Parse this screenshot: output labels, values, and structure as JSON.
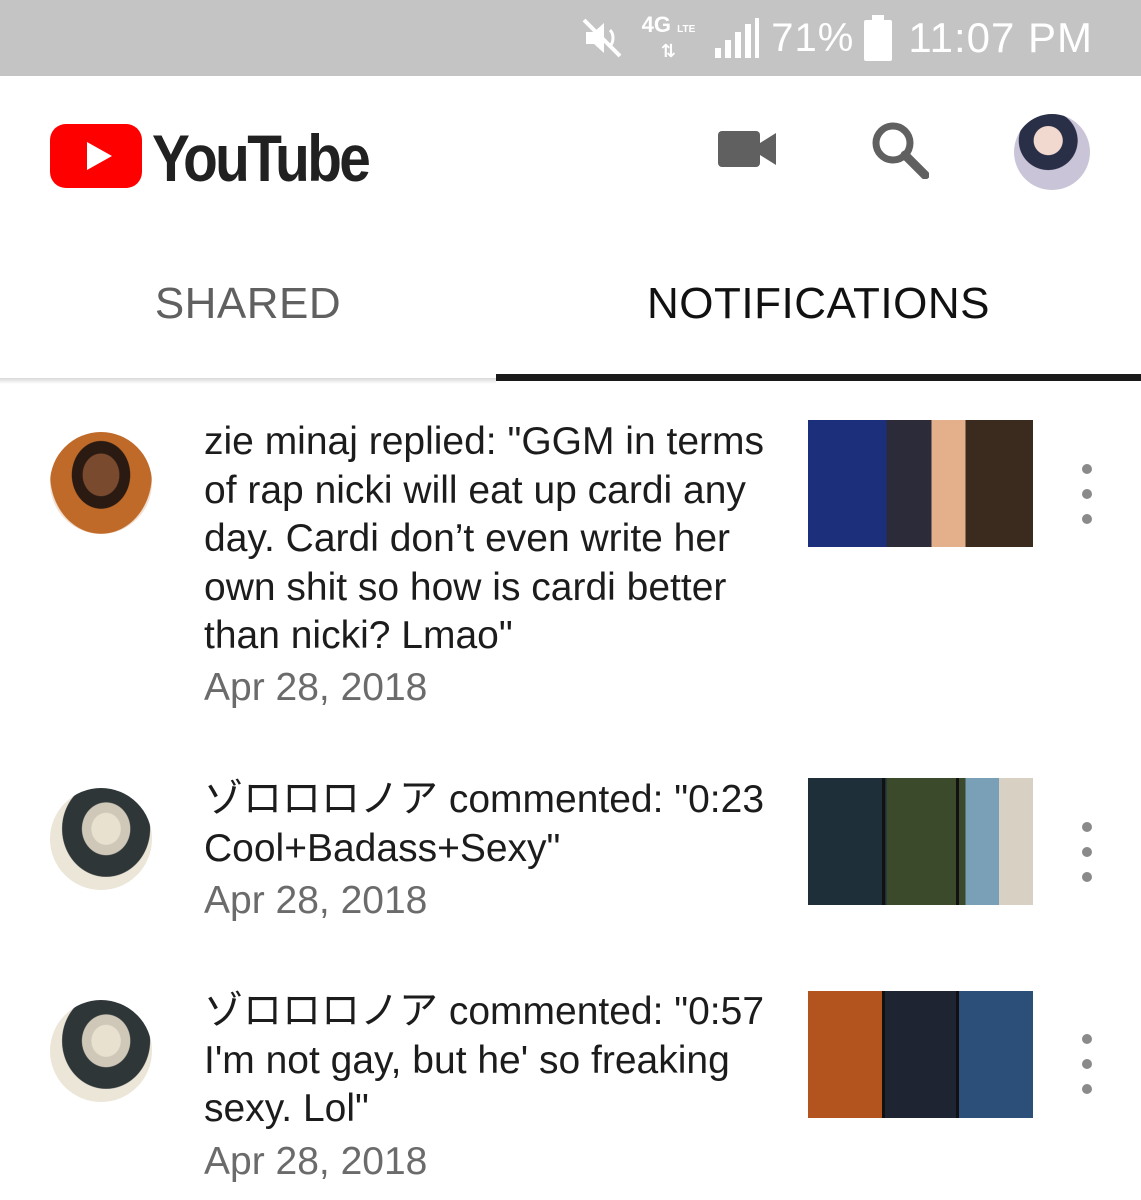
{
  "status_bar": {
    "network": "4G",
    "network_sub": "LTE",
    "battery": "71%",
    "time": "11:07 PM",
    "icons": [
      "mute-icon",
      "network-4g-icon",
      "signal-icon",
      "battery-icon"
    ]
  },
  "app_bar": {
    "logo_text": "YouTube",
    "icons": [
      "camera-icon",
      "search-icon",
      "avatar"
    ]
  },
  "tabs": [
    {
      "label": "SHARED",
      "active": false
    },
    {
      "label": "NOTIFICATIONS",
      "active": true
    }
  ],
  "notifications": [
    {
      "text": "zie minaj replied: \"GGM in terms of rap nicki will eat up cardi any day. Cardi don’t even write her own shit so how is cardi better than nicki? Lmao\"",
      "date": "Apr 28, 2018"
    },
    {
      "text": "ゾロロロノア commented: \"0:23 Cool+Badass+Sexy\"",
      "date": "Apr 28, 2018"
    },
    {
      "text": "ゾロロロノア commented: \"0:57 I'm not gay, but he' so freaking sexy. Lol\"",
      "date": "Apr 28, 2018"
    }
  ],
  "colors": {
    "status_bar_bg": "#c4c4c4",
    "youtube_red": "#ff0000",
    "tab_indicator": "#1a1a1a",
    "icon_gray": "#606060"
  }
}
